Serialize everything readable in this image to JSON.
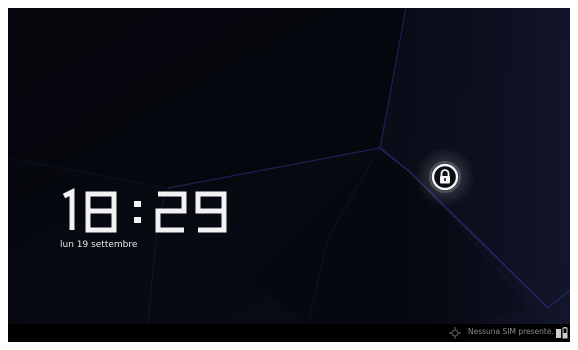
{
  "lockscreen": {
    "time": "18:29",
    "date": "lun 19 settembre"
  },
  "lock_icon": {
    "name": "padlock-icon"
  },
  "statusbar": {
    "sim_status": "Nessuna SIM presente.",
    "icons": [
      "gps-icon",
      "battery-icon"
    ]
  },
  "colors": {
    "background": "#05070c",
    "statusbar": "#000000",
    "accent_line": "#2a2f7a",
    "text": "#e8e8e8"
  }
}
